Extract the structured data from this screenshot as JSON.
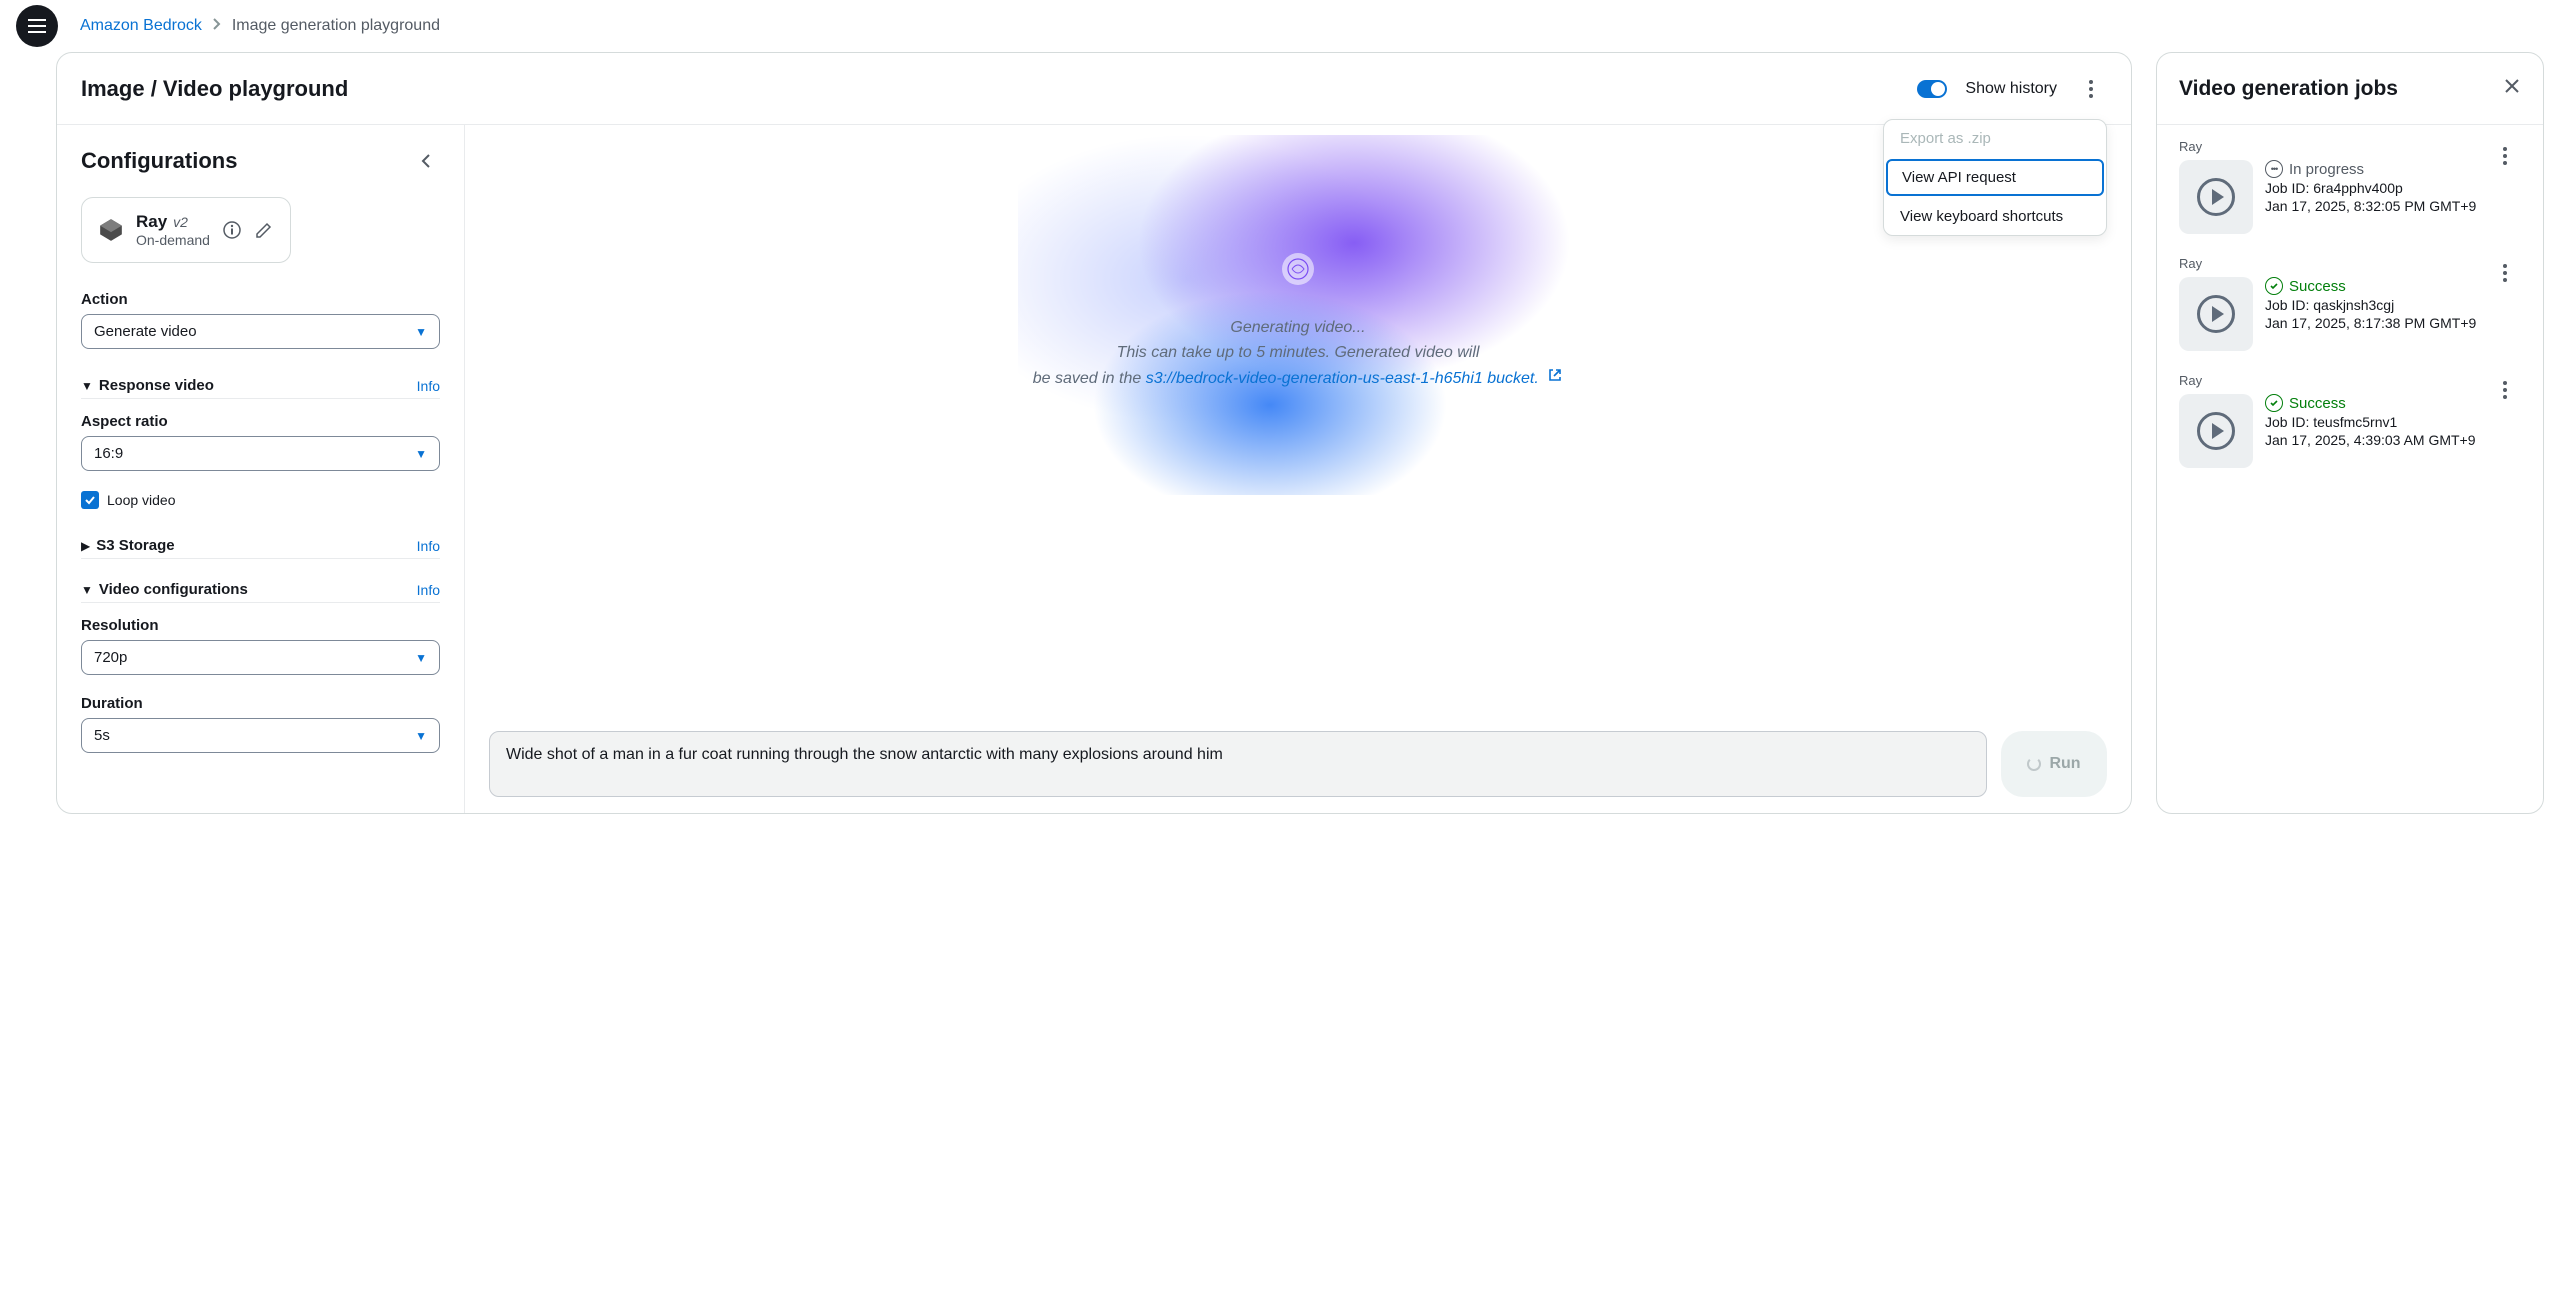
{
  "breadcrumb": {
    "root": "Amazon Bedrock",
    "current": "Image generation playground"
  },
  "playground": {
    "title": "Image / Video playground",
    "show_history_label": "Show history"
  },
  "menu": {
    "export_zip": "Export as .zip",
    "view_api": "View API request",
    "view_shortcuts": "View keyboard shortcuts"
  },
  "config": {
    "title": "Configurations",
    "model_name": "Ray",
    "model_version": "v2",
    "model_sub": "On-demand",
    "action_label": "Action",
    "action_value": "Generate video",
    "response_video_title": "Response video",
    "aspect_label": "Aspect ratio",
    "aspect_value": "16:9",
    "loop_video_label": "Loop video",
    "s3_title": "S3 Storage",
    "video_config_title": "Video configurations",
    "resolution_label": "Resolution",
    "resolution_value": "720p",
    "duration_label": "Duration",
    "duration_value": "5s",
    "info_link": "Info"
  },
  "generation": {
    "line1": "Generating video...",
    "line2_a": "This can take up to 5 minutes. Generated video will",
    "line2_b": "be saved in the ",
    "bucket": "s3://bedrock-video-generation-us-east-1-h65hi1 bucket."
  },
  "prompt": {
    "value": "Wide shot of a man in a fur coat running through the snow antarctic with many explosions around him",
    "run_label": "Run"
  },
  "jobs": {
    "title": "Video generation jobs",
    "items": [
      {
        "model": "Ray",
        "status": "In progress",
        "status_type": "progress",
        "job_id": "Job ID: 6ra4pphv400p",
        "ts": "Jan 17, 2025, 8:32:05 PM GMT+9"
      },
      {
        "model": "Ray",
        "status": "Success",
        "status_type": "success",
        "job_id": "Job ID: qaskjnsh3cgj",
        "ts": "Jan 17, 2025, 8:17:38 PM GMT+9"
      },
      {
        "model": "Ray",
        "status": "Success",
        "status_type": "success",
        "job_id": "Job ID: teusfmc5rnv1",
        "ts": "Jan 17, 2025, 4:39:03 AM GMT+9"
      }
    ]
  }
}
